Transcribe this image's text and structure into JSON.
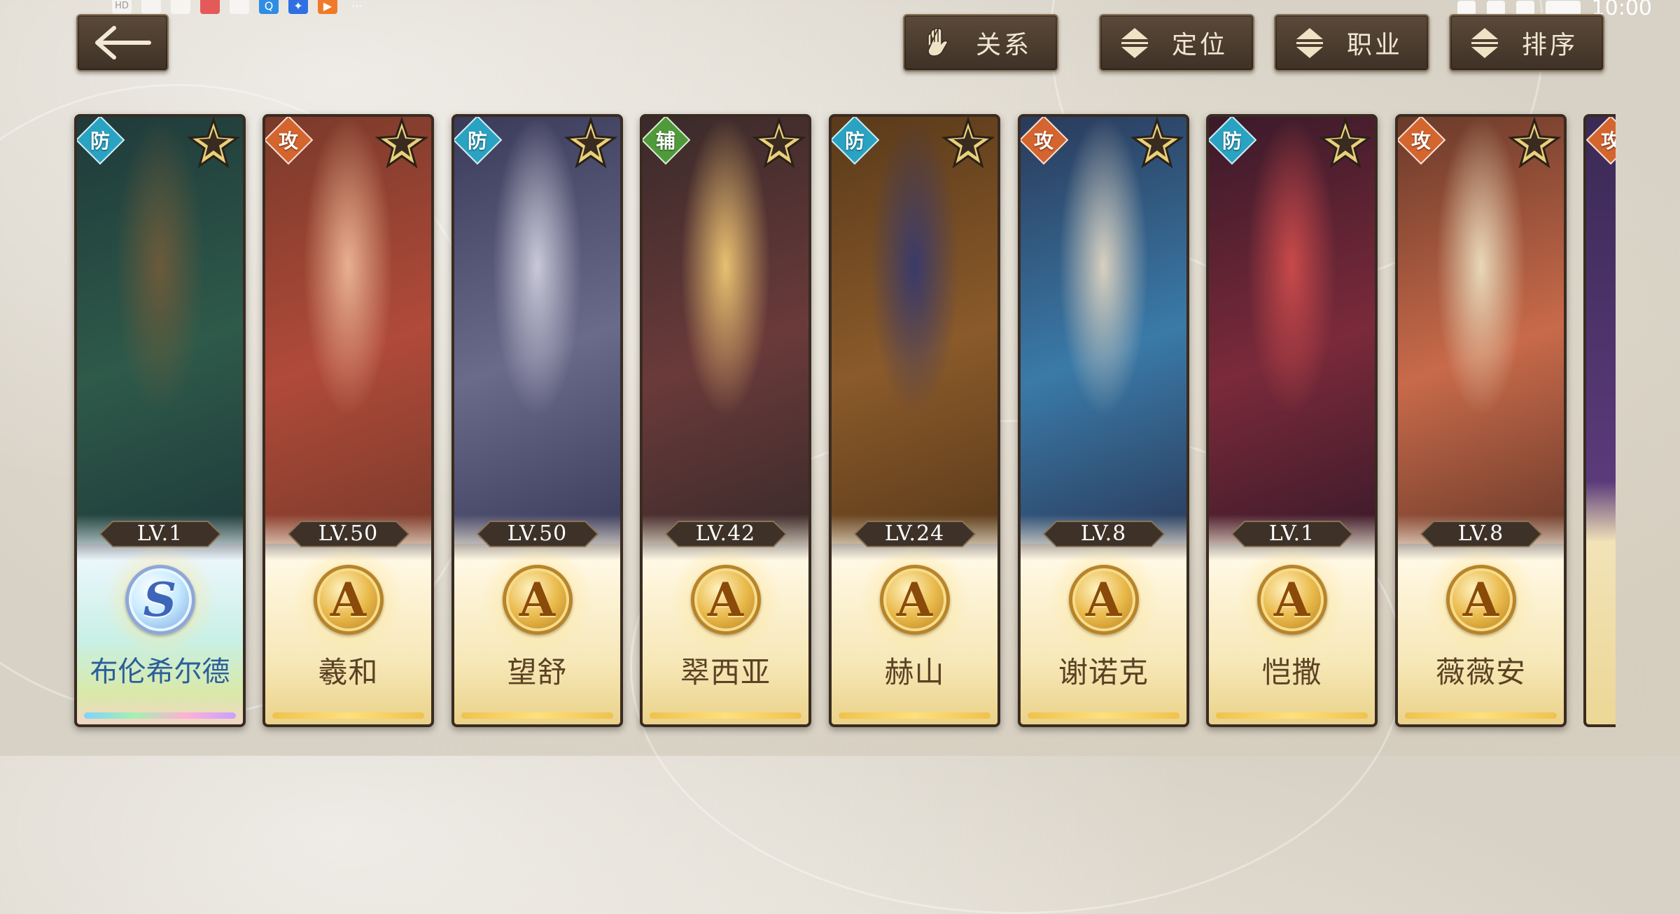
{
  "toolbar": {
    "back_icon": "back-arrow-icon",
    "filters": [
      {
        "label": "关系",
        "icon": "glove-icon"
      },
      {
        "label": "定位",
        "icon": "sort-arrows-icon"
      },
      {
        "label": "职业",
        "icon": "sort-arrows-icon"
      },
      {
        "label": "排序",
        "icon": "sort-arrows-icon"
      }
    ]
  },
  "status_bar": {
    "time": "10:00"
  },
  "characters": [
    {
      "role": "防",
      "level": "LV.1",
      "rank": "S",
      "name": "布伦希尔德"
    },
    {
      "role": "攻",
      "level": "LV.50",
      "rank": "A",
      "name": "羲和"
    },
    {
      "role": "防",
      "level": "LV.50",
      "rank": "A",
      "name": "望舒"
    },
    {
      "role": "辅",
      "level": "LV.42",
      "rank": "A",
      "name": "翠西亚"
    },
    {
      "role": "防",
      "level": "LV.24",
      "rank": "A",
      "name": "赫山"
    },
    {
      "role": "攻",
      "level": "LV.8",
      "rank": "A",
      "name": "谢诺克"
    },
    {
      "role": "防",
      "level": "LV.1",
      "rank": "A",
      "name": "恺撒"
    },
    {
      "role": "攻",
      "level": "LV.8",
      "rank": "A",
      "name": "薇薇安"
    }
  ],
  "partial_card": {
    "role": "攻"
  },
  "colors": {
    "role_def": "#2aa3c2",
    "role_atk": "#d4652e",
    "role_sup": "#4f9a3a",
    "gold": "#e9b94a"
  }
}
